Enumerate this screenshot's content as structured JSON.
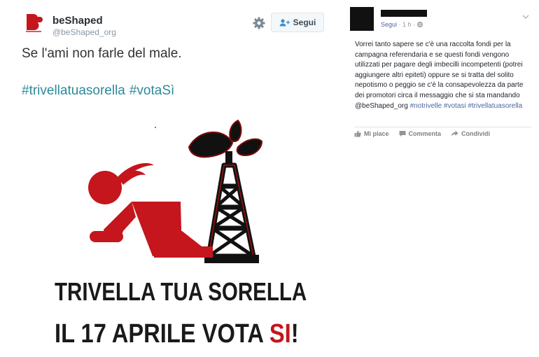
{
  "tweet": {
    "display_name": "beShaped",
    "handle": "@beShaped_org",
    "follow_label": "Segui",
    "text": "Se l'ami non farle del male.",
    "hashtags": [
      "#trivellatuasorella",
      "#votaSì"
    ],
    "icons": [
      "beshaped-logo",
      "gear-icon",
      "add-user-icon"
    ],
    "poster": {
      "line1": "TRIVELLA TUA SORELLA",
      "line2_prefix": "IL 17 APRILE VOTA ",
      "line2_highlight": "SI",
      "line2_suffix": "!",
      "accent_color": "#c4161c"
    }
  },
  "comment": {
    "follow_link": "Segui",
    "time": "· 1 h ·",
    "text": "Vorrei tanto sapere se c'è una raccolta fondi per la campagna referendaria e se questi fondi vengono utilizzati per pagare degli imbecilli incompetenti (potrei aggiungere altri epiteti) oppure se si tratta del solito nepotismo o peggio se c'è la consapevolezza da parte dei promotori circa il messaggio che si sta mandando @beShaped_org",
    "hashtags": "#notrivelle #votasi #trivellatuasorella",
    "actions": {
      "like": "Mi piace",
      "comment": "Commenta",
      "share": "Condividi"
    },
    "link_color": "#4b67a1"
  }
}
